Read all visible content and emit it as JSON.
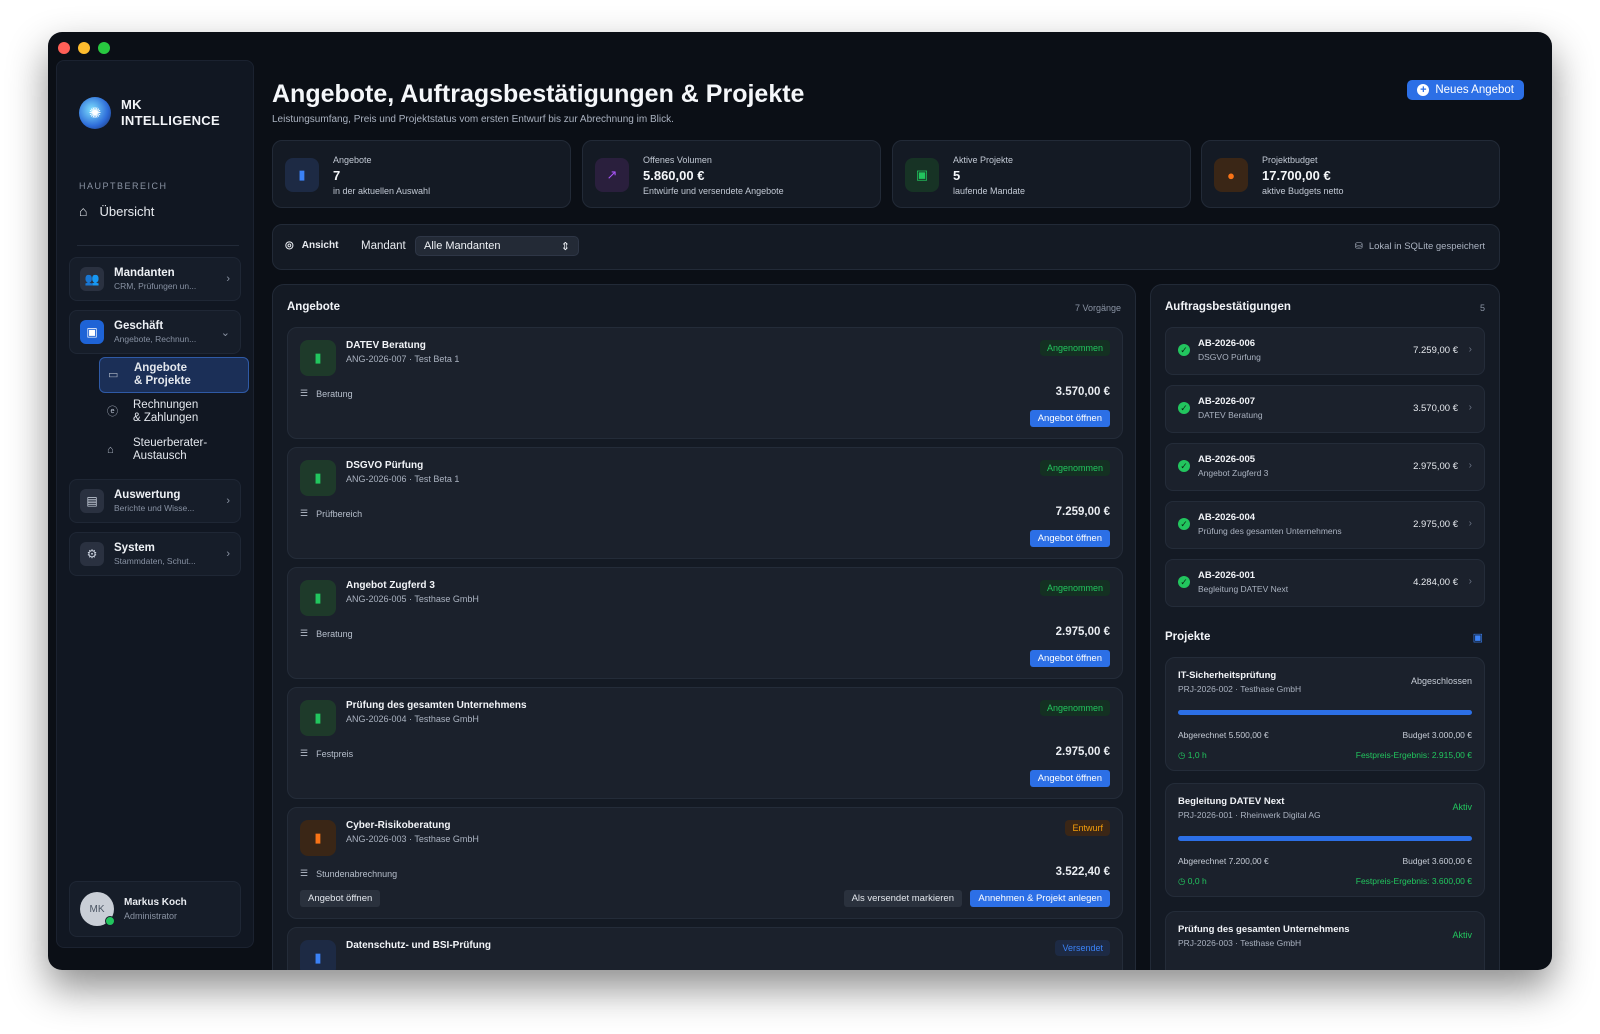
{
  "colors": {
    "accent": "#2c6fe6",
    "success": "#22c55e",
    "warning": "#f59e0b",
    "window_bg": "#0b0f16"
  },
  "brand": {
    "line1": "MK",
    "line2": "INTELLIGENCE"
  },
  "sidebar": {
    "section_label": "HAUPTBEREICH",
    "overview": "Übersicht",
    "groups": [
      {
        "title": "Mandanten",
        "subtitle": "CRM, Prüfungen un...",
        "icon": "users-icon"
      },
      {
        "title": "Geschäft",
        "subtitle": "Angebote, Rechnun...",
        "icon": "briefcase-icon"
      },
      {
        "title": "Auswertung",
        "subtitle": "Berichte und Wisse...",
        "icon": "document-icon"
      },
      {
        "title": "System",
        "subtitle": "Stammdaten, Schut...",
        "icon": "gear-icon"
      }
    ],
    "sub_items": [
      {
        "line1": "Angebote",
        "line2": "& Projekte"
      },
      {
        "line1": "Rechnungen",
        "line2": "& Zahlungen"
      },
      {
        "line1": "Steuerberater-",
        "line2": "Austausch"
      }
    ],
    "user": {
      "initials": "MK",
      "name": "Markus Koch",
      "role": "Administrator"
    }
  },
  "header": {
    "title": "Angebote, Auftragsbestätigungen & Projekte",
    "subtitle": "Leistungsumfang, Preis und Projektstatus vom ersten Entwurf bis zur Abrechnung im Blick.",
    "new_button": "Neues Angebot"
  },
  "stats": [
    {
      "label": "Angebote",
      "value": "7",
      "note": "in der aktuellen Auswahl",
      "icon": "document-icon"
    },
    {
      "label": "Offenes Volumen",
      "value": "5.860,00 €",
      "note": "Entwürfe und versendete Angebote",
      "icon": "chart-icon"
    },
    {
      "label": "Aktive Projekte",
      "value": "5",
      "note": "laufende Mandate",
      "icon": "briefcase-icon"
    },
    {
      "label": "Projektbudget",
      "value": "17.700,00 €",
      "note": "aktive Budgets netto",
      "icon": "euro-icon"
    }
  ],
  "filter": {
    "view_label": "Ansicht",
    "client_label": "Mandant",
    "client_value": "Alle Mandanten",
    "storage_note": "Lokal in SQLite gespeichert"
  },
  "offers": {
    "title": "Angebote",
    "count": "7 Vorgänge",
    "items": [
      {
        "title": "DATEV Beratung",
        "subtitle": "ANG-2026-007 · Test Beta 1",
        "status": "Angenommen",
        "category": "Beratung",
        "amount": "3.570,00 €",
        "open": "Angebot öffnen"
      },
      {
        "title": "DSGVO Pürfung",
        "subtitle": "ANG-2026-006 · Test Beta 1",
        "status": "Angenommen",
        "category": "Prüfbereich",
        "amount": "7.259,00 €",
        "open": "Angebot öffnen"
      },
      {
        "title": "Angebot Zugferd 3",
        "subtitle": "ANG-2026-005 · Testhase GmbH",
        "status": "Angenommen",
        "category": "Beratung",
        "amount": "2.975,00 €",
        "open": "Angebot öffnen"
      },
      {
        "title": "Prüfung des gesamten Unternehmens",
        "subtitle": "ANG-2026-004 · Testhase GmbH",
        "status": "Angenommen",
        "category": "Festpreis",
        "amount": "2.975,00 €",
        "open": "Angebot öffnen"
      },
      {
        "title": "Cyber-Risikoberatung",
        "subtitle": "ANG-2026-003 · Testhase GmbH",
        "status": "Entwurf",
        "category": "Stundenabrechnung",
        "amount": "3.522,40 €",
        "open": "Angebot öffnen",
        "mark_sent": "Als versendet markieren",
        "accept": "Annehmen & Projekt anlegen"
      },
      {
        "title": "Datenschutz- und BSI-Prüfung",
        "status": "Versendet"
      }
    ]
  },
  "confirmations": {
    "title": "Auftragsbestätigungen",
    "count": "5",
    "items": [
      {
        "id": "AB-2026-006",
        "name": "DSGVO Pürfung",
        "amount": "7.259,00 €"
      },
      {
        "id": "AB-2026-007",
        "name": "DATEV Beratung",
        "amount": "3.570,00 €"
      },
      {
        "id": "AB-2026-005",
        "name": "Angebot Zugferd 3",
        "amount": "2.975,00 €"
      },
      {
        "id": "AB-2026-004",
        "name": "Prüfung des gesamten Unternehmens",
        "amount": "2.975,00 €"
      },
      {
        "id": "AB-2026-001",
        "name": "Begleitung DATEV Next",
        "amount": "4.284,00 €"
      }
    ]
  },
  "projects": {
    "title": "Projekte",
    "items": [
      {
        "title": "IT-Sicherheitsprüfung",
        "subtitle": "PRJ-2026-002 · Testhase GmbH",
        "status": "Abgeschlossen",
        "billed": "Abgerechnet 5.500,00 €",
        "budget": "Budget 3.000,00 €",
        "hours": "1,0 h",
        "result": "Festpreis-Ergebnis: 2.915,00 €"
      },
      {
        "title": "Begleitung DATEV Next",
        "subtitle": "PRJ-2026-001 · Rheinwerk Digital AG",
        "status": "Aktiv",
        "billed": "Abgerechnet 7.200,00 €",
        "budget": "Budget 3.600,00 €",
        "hours": "0,0 h",
        "result": "Festpreis-Ergebnis: 3.600,00 €"
      },
      {
        "title": "Prüfung des gesamten Unternehmens",
        "subtitle": "PRJ-2026-003 · Testhase GmbH",
        "status": "Aktiv"
      }
    ]
  }
}
